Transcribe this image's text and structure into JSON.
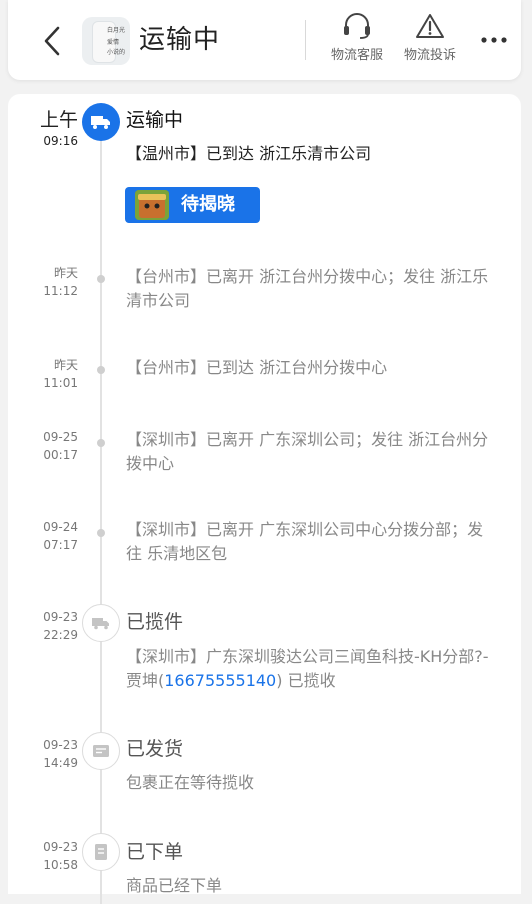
{
  "header": {
    "title": "运输中",
    "thumb_lines": [
      "白月光",
      "爱情",
      "小说的"
    ],
    "actions": [
      {
        "label": "物流客服",
        "icon": "headset-icon"
      },
      {
        "label": "物流投诉",
        "icon": "warning-icon"
      }
    ],
    "more_icon": "more-dots-icon"
  },
  "timeline": {
    "current": {
      "time_line1": "上午",
      "time_line2": "09:16",
      "status": "运输中",
      "description": "【温州市】已到达 浙江乐清市公司",
      "badge_label": "待揭晓",
      "icon": "truck-icon"
    },
    "events": [
      {
        "time_line1": "昨天",
        "time_line2": "11:12",
        "description": "【台州市】已离开 浙江台州分拨中心；发往 浙江乐清市公司"
      },
      {
        "time_line1": "昨天",
        "time_line2": "11:01",
        "description": "【台州市】已到达 浙江台州分拨中心"
      },
      {
        "time_line1": "09-25",
        "time_line2": "00:17",
        "description": "【深圳市】已离开 广东深圳公司；发往 浙江台州分拨中心"
      },
      {
        "time_line1": "09-24",
        "time_line2": "07:17",
        "description": "【深圳市】已离开 广东深圳公司中心分拨分部；发往 乐清地区包"
      }
    ],
    "milestones": [
      {
        "time_line1": "09-23",
        "time_line2": "22:29",
        "status": "已揽件",
        "desc_before": "【深圳市】广东深圳骏达公司三闻鱼科技-KH分部?-贾坤(",
        "phone": "16675555140",
        "desc_after": ") 已揽收",
        "icon": "pickup-truck-icon"
      },
      {
        "time_line1": "09-23",
        "time_line2": "14:49",
        "status": "已发货",
        "description": "包裹正在等待揽收",
        "icon": "package-box-icon"
      },
      {
        "time_line1": "09-23",
        "time_line2": "10:58",
        "status": "已下单",
        "description": "商品已经下单",
        "icon": "order-document-icon"
      }
    ]
  }
}
